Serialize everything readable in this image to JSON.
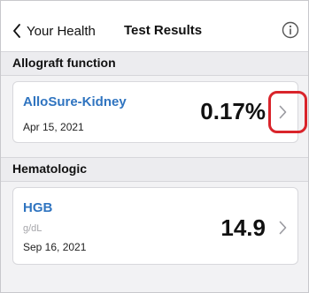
{
  "header": {
    "back_label": "Your Health",
    "title": "Test Results"
  },
  "sections": [
    {
      "title": "Allograft function",
      "result": {
        "name": "AlloSure-Kidney",
        "unit": "",
        "date": "Apr 15, 2021",
        "value": "0.17%"
      }
    },
    {
      "title": "Hematologic",
      "result": {
        "name": "HGB",
        "unit": "g/dL",
        "date": "Sep 16, 2021",
        "value": "14.9"
      }
    }
  ],
  "colors": {
    "link_blue": "#2f74c0",
    "highlight_red": "#d9242b"
  },
  "icons": {
    "back": "chevron-left-icon",
    "info": "info-icon",
    "row_disclosure": "chevron-right-icon"
  }
}
